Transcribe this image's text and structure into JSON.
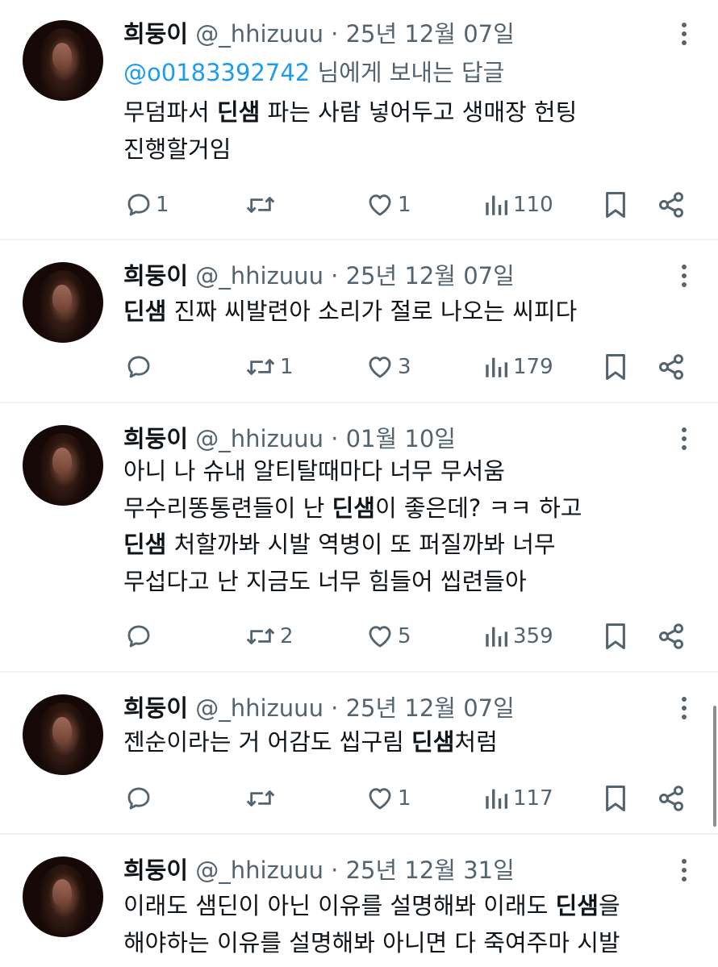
{
  "tweets": [
    {
      "name": "희둥이",
      "handle": "@_hhizuuu",
      "separator": "·",
      "date": "25년 12월 07일",
      "reply_to": {
        "mention": "@o0183392742",
        "text": " 님에게 보내는 답글"
      },
      "lines": [
        [
          {
            "t": "무덤파서 "
          },
          {
            "t": "딘샘",
            "b": true
          },
          {
            "t": " 파는 사람 넣어두고 생매장 헌팅"
          }
        ],
        [
          {
            "t": "진행할거임"
          }
        ]
      ],
      "stats": {
        "replies": "1",
        "reposts": "",
        "likes": "1",
        "views": "110"
      }
    },
    {
      "name": "희둥이",
      "handle": "@_hhizuuu",
      "separator": "·",
      "date": "25년 12월 07일",
      "reply_to": null,
      "lines": [
        [
          {
            "t": "딘샘",
            "b": true
          },
          {
            "t": " 진짜 씨발련아 소리가 절로 나오는 씨피다"
          }
        ]
      ],
      "stats": {
        "replies": "",
        "reposts": "1",
        "likes": "3",
        "views": "179"
      }
    },
    {
      "name": "희둥이",
      "handle": "@_hhizuuu",
      "separator": "·",
      "date": "01월 10일",
      "reply_to": null,
      "lines": [
        [
          {
            "t": "아니 나 슈내 알티탈때마다 너무 무서움"
          }
        ],
        [
          {
            "t": "무수리똥통련들이 난 "
          },
          {
            "t": "딘샘",
            "b": true
          },
          {
            "t": "이 좋은데? ㅋㅋ 하고"
          }
        ],
        [
          {
            "t": "딘샘",
            "b": true
          },
          {
            "t": " 처할까봐 시발 역병이 또 퍼질까봐 너무"
          }
        ],
        [
          {
            "t": "무섭다고 난 지금도 너무 힘들어 씹련들아"
          }
        ]
      ],
      "stats": {
        "replies": "",
        "reposts": "2",
        "likes": "5",
        "views": "359"
      }
    },
    {
      "name": "희둥이",
      "handle": "@_hhizuuu",
      "separator": "·",
      "date": "25년 12월 07일",
      "reply_to": null,
      "lines": [
        [
          {
            "t": "젠순이라는 거 어감도 씹구림 "
          },
          {
            "t": "딘샘",
            "b": true
          },
          {
            "t": "처럼"
          }
        ]
      ],
      "stats": {
        "replies": "",
        "reposts": "",
        "likes": "1",
        "views": "117"
      }
    },
    {
      "name": "희둥이",
      "handle": "@_hhizuuu",
      "separator": "·",
      "date": "25년 12월 31일",
      "reply_to": null,
      "lines": [
        [
          {
            "t": "이래도 샘딘이 아닌 이유를 설명해봐 이래도 "
          },
          {
            "t": "딘샘",
            "b": true
          },
          {
            "t": "을"
          }
        ],
        [
          {
            "t": "해야하는 이유를 설명해봐 아니면 다 죽여주마 시발"
          }
        ]
      ],
      "stats": null
    }
  ],
  "icons": {
    "reply": "reply-icon",
    "repost": "repost-icon",
    "like": "heart-icon",
    "views": "views-icon",
    "bookmark": "bookmark-icon",
    "share": "share-icon",
    "more": "more-dots-icon"
  },
  "colors": {
    "text": "#0f1419",
    "secondary": "#536471",
    "mention": "#1d9bf0",
    "divider": "#eff3f4"
  }
}
